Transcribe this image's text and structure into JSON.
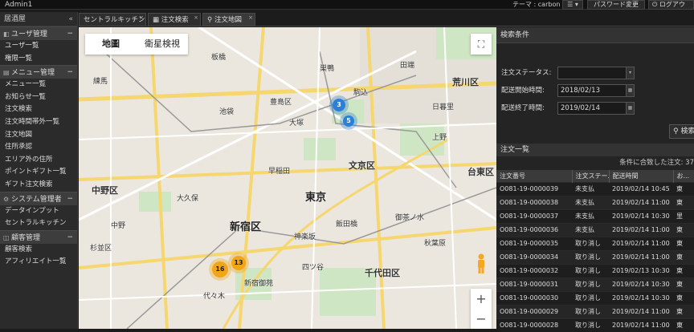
{
  "topbar": {
    "user": "Admin1",
    "theme": "テーマ : carbon",
    "menu_icon": "☰ ▾",
    "password_button": "パスワード変更",
    "logout_button": "ログアウ"
  },
  "sidebar": {
    "title": "居酒屋",
    "collapse_icon": "«",
    "sections": [
      {
        "label": "ユーザ管理",
        "items": [
          "ユーザ一覧",
          "権限一覧"
        ]
      },
      {
        "label": "メニュー管理",
        "items": [
          "メニュー一覧",
          "お知らせ一覧",
          "注文検索",
          "注文時間帯外一覧",
          "注文地図",
          "住所承認",
          "エリア外の住所",
          "ポイントギフト一覧",
          "ギフト注文検索"
        ]
      },
      {
        "label": "システム管理者",
        "items": [
          "データインプット",
          "セントラルキッチン"
        ]
      },
      {
        "label": "顧客管理",
        "items": [
          "顧客検索",
          "アフィリエイト一覧"
        ]
      }
    ]
  },
  "tabs": [
    "セントラルキッチン",
    "注文検索",
    "注文地図"
  ],
  "map": {
    "type_map": "地圖",
    "type_satellite": "衛星検視",
    "zoom_in": "+",
    "zoom_out": "−",
    "clusters": [
      "3",
      "5",
      "16",
      "13"
    ],
    "labels": {
      "nakano": "中野区",
      "shinjuku": "新宿区",
      "bunkyo": "文京区",
      "tokyo": "東京",
      "chiyoda": "千代田区",
      "arakawa": "荒川区",
      "taito": "台東区",
      "toshima": "豊島区",
      "ikebukuro": "池袋",
      "komagome": "駒込",
      "okubo": "大久保",
      "waseda": "早稲田",
      "nerima": "練馬",
      "itabashi": "板橋",
      "ueno": "上野",
      "suginami": "杉並区",
      "yoyogi": "代々木",
      "nishiogikubo": "中野",
      "yotsuya": "四ツ谷",
      "iidabashi": "飯田橋",
      "sugamo": "巣鴨",
      "otsuka": "大塚",
      "tabata": "田端",
      "nippori": "日暮里",
      "kagurazaka": "神楽坂",
      "ochanomizu": "御茶ノ水",
      "shinjuku_gyoen": "新宿御苑",
      "akihabara": "秋葉原"
    }
  },
  "search": {
    "title": "検索条件",
    "status_label": "注文ステータス:",
    "status_value": "",
    "start_label": "配送開始時間:",
    "start_value": "2018/02/13",
    "end_label": "配送終了時間:",
    "end_value": "2019/02/14",
    "search_button": "検索"
  },
  "orders": {
    "title": "注文一覧",
    "count_text": "条件に合致した注文: 37",
    "columns": [
      "注文番号",
      "注文ステー...",
      "配送時間",
      "お..."
    ],
    "rows": [
      [
        "O081-19-0000039",
        "未支払",
        "2019/02/14 10:45",
        "東"
      ],
      [
        "O081-19-0000038",
        "未支払",
        "2019/02/14 11:00",
        "東"
      ],
      [
        "O081-19-0000037",
        "未支払",
        "2019/02/14 10:30",
        "里"
      ],
      [
        "O081-19-0000036",
        "未支払",
        "2019/02/14 11:00",
        "東"
      ],
      [
        "O081-19-0000035",
        "取り消し",
        "2019/02/14 11:00",
        "東"
      ],
      [
        "O081-19-0000034",
        "取り消し",
        "2019/02/14 11:00",
        "東"
      ],
      [
        "O081-19-0000032",
        "取り消し",
        "2019/02/13 10:30",
        "東"
      ],
      [
        "O081-19-0000031",
        "取り消し",
        "2019/02/14 10:30",
        "東"
      ],
      [
        "O081-19-0000030",
        "取り消し",
        "2019/02/14 10:30",
        "東"
      ],
      [
        "O081-19-0000029",
        "取り消し",
        "2019/02/14 11:00",
        "東"
      ],
      [
        "O081-19-0000028",
        "取り消し",
        "2019/02/14 11:00",
        "東"
      ]
    ]
  }
}
